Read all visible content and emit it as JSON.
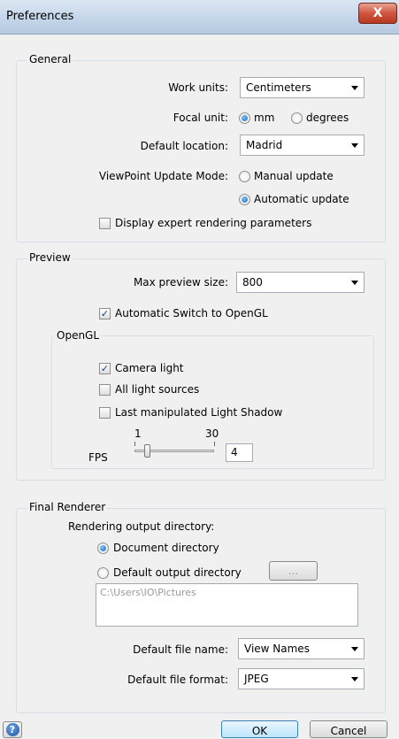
{
  "window": {
    "title": "Preferences",
    "close_glyph": "X"
  },
  "general": {
    "title": "General",
    "work_units_label": "Work units:",
    "work_units_value": "Centimeters",
    "focal_unit_label": "Focal unit:",
    "focal_options": [
      "mm",
      "degrees"
    ],
    "focal_selected": "mm",
    "default_location_label": "Default location:",
    "default_location_value": "Madrid",
    "viewpoint_label": "ViewPoint Update Mode:",
    "viewpoint_options": [
      "Manual update",
      "Automatic update"
    ],
    "viewpoint_selected": "Automatic update",
    "expert_label": "Display expert rendering parameters",
    "expert_checked": false
  },
  "preview": {
    "title": "Preview",
    "max_size_label": "Max preview size:",
    "max_size_value": "800",
    "auto_switch_label": "Automatic Switch to OpenGL",
    "auto_switch_checked": true,
    "opengl": {
      "title": "OpenGL",
      "camera_light_label": "Camera light",
      "camera_light_checked": true,
      "all_lights_label": "All light sources",
      "all_lights_checked": false,
      "last_shadow_label": "Last manipulated Light Shadow",
      "last_shadow_checked": false,
      "fps_label": "FPS",
      "fps_min": "1",
      "fps_max": "30",
      "fps_value": "4"
    }
  },
  "final_renderer": {
    "title": "Final Renderer",
    "output_dir_label": "Rendering output directory:",
    "doc_dir_label": "Document directory",
    "default_dir_label": "Default output directory",
    "selected": "Document directory",
    "browse_label": "...",
    "path_value": "C:\\Users\\IO\\Pictures",
    "file_name_label": "Default file name:",
    "file_name_value": "View Names",
    "file_format_label": "Default file format:",
    "file_format_value": "JPEG"
  },
  "footer": {
    "help_glyph": "?",
    "ok_label": "OK",
    "cancel_label": "Cancel"
  },
  "icons": [
    "close-icon",
    "help-icon",
    "dropdown-arrow-icon",
    "checkmark-icon"
  ]
}
